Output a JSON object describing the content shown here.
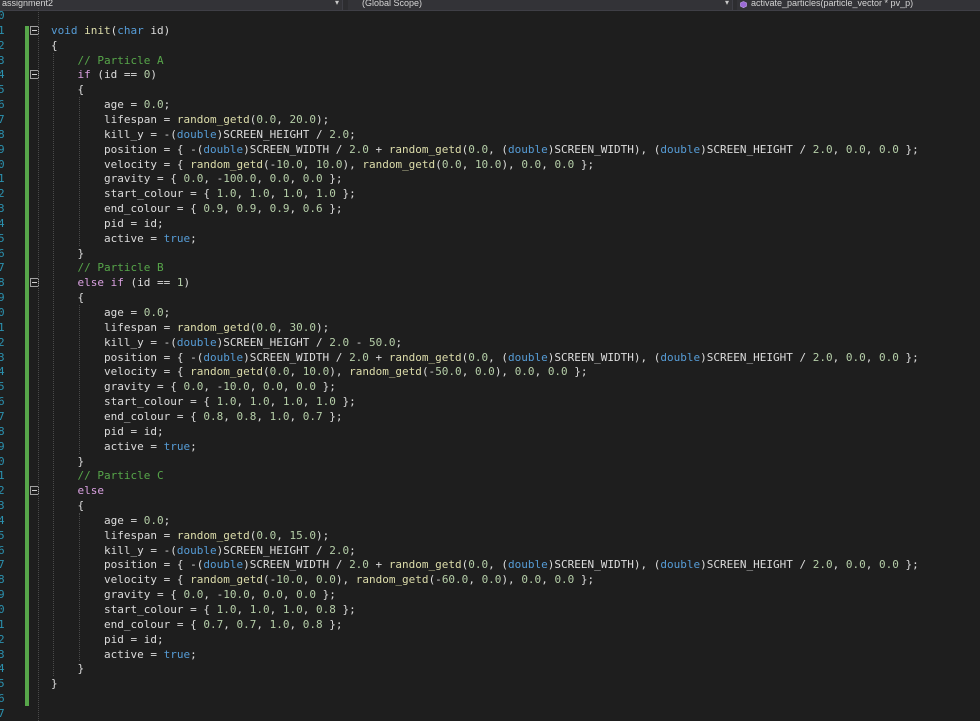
{
  "navbar": {
    "project": "assignment2",
    "scope": "(Global Scope)",
    "member": "activate_particles(particle_vector * pv_p)",
    "member_icon": "cube-icon"
  },
  "colors": {
    "keyword": "#569cd6",
    "control": "#d8a0df",
    "function": "#dcdcaa",
    "number": "#b5cea8",
    "comment": "#57a64a",
    "line_number": "#2b91af",
    "change_bar": "#57a64a"
  },
  "line_numbers": [
    "0",
    "1",
    "2",
    "3",
    "4",
    "5",
    "6",
    "7",
    "8",
    "9",
    "0",
    "1",
    "2",
    "3",
    "4",
    "5",
    "6",
    "7",
    "8",
    "9",
    "0",
    "1",
    "2",
    "3",
    "4",
    "5",
    "6",
    "7",
    "8",
    "9",
    "0",
    "1",
    "2",
    "3",
    "4",
    "5",
    "6",
    "7",
    "8",
    "9",
    "0",
    "1",
    "2",
    "3",
    "4",
    "5",
    "6",
    "7"
  ],
  "code": [
    "",
    "void init(char id)",
    "{",
    "    // Particle A",
    "    if (id == 0)",
    "    {",
    "        age = 0.0;",
    "        lifespan = random_getd(0.0, 20.0);",
    "        kill_y = -(double)SCREEN_HEIGHT / 2.0;",
    "        position = { -(double)SCREEN_WIDTH / 2.0 + random_getd(0.0, (double)SCREEN_WIDTH), (double)SCREEN_HEIGHT / 2.0, 0.0, 0.0 };",
    "        velocity = { random_getd(-10.0, 10.0), random_getd(0.0, 10.0), 0.0, 0.0 };",
    "        gravity = { 0.0, -100.0, 0.0, 0.0 };",
    "        start_colour = { 1.0, 1.0, 1.0, 1.0 };",
    "        end_colour = { 0.9, 0.9, 0.9, 0.6 };",
    "        pid = id;",
    "        active = true;",
    "    }",
    "    // Particle B",
    "    else if (id == 1)",
    "    {",
    "        age = 0.0;",
    "        lifespan = random_getd(0.0, 30.0);",
    "        kill_y = -(double)SCREEN_HEIGHT / 2.0 - 50.0;",
    "        position = { -(double)SCREEN_WIDTH / 2.0 + random_getd(0.0, (double)SCREEN_WIDTH), (double)SCREEN_HEIGHT / 2.0, 0.0, 0.0 };",
    "        velocity = { random_getd(0.0, 10.0), random_getd(-50.0, 0.0), 0.0, 0.0 };",
    "        gravity = { 0.0, -10.0, 0.0, 0.0 };",
    "        start_colour = { 1.0, 1.0, 1.0, 1.0 };",
    "        end_colour = { 0.8, 0.8, 1.0, 0.7 };",
    "        pid = id;",
    "        active = true;",
    "    }",
    "    // Particle C",
    "    else",
    "    {",
    "        age = 0.0;",
    "        lifespan = random_getd(0.0, 15.0);",
    "        kill_y = -(double)SCREEN_HEIGHT / 2.0;",
    "        position = { -(double)SCREEN_WIDTH / 2.0 + random_getd(0.0, (double)SCREEN_WIDTH), (double)SCREEN_HEIGHT / 2.0, 0.0, 0.0 };",
    "        velocity = { random_getd(-10.0, 0.0), random_getd(-60.0, 0.0), 0.0, 0.0 };",
    "        gravity = { 0.0, -10.0, 0.0, 0.0 };",
    "        start_colour = { 1.0, 1.0, 1.0, 0.8 };",
    "        end_colour = { 0.7, 0.7, 1.0, 0.8 };",
    "        pid = id;",
    "        active = true;",
    "    }",
    "}",
    "",
    ""
  ],
  "fold_lines": [
    1,
    4,
    18,
    32
  ]
}
